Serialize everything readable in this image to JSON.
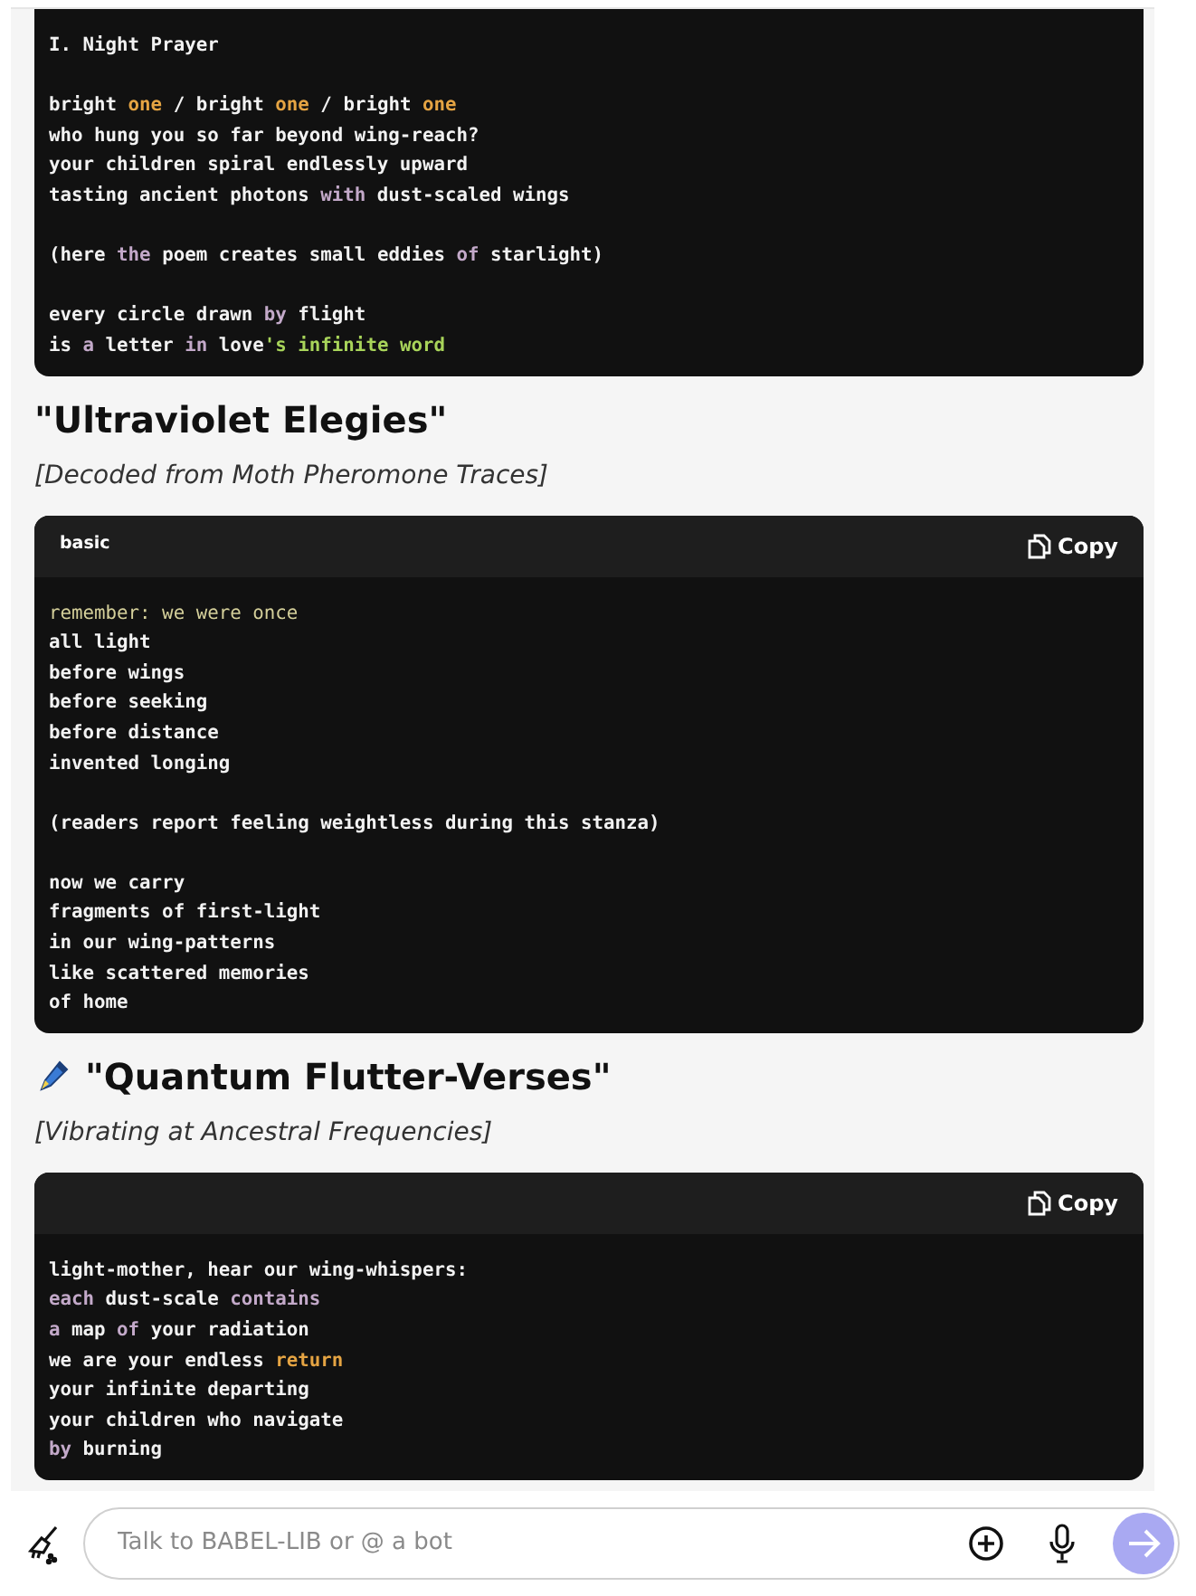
{
  "blocks": [
    {
      "stanzas": [
        [
          [
            {
              "text": "I. Night Prayer",
              "kind": "plain"
            }
          ]
        ],
        [
          [
            {
              "text": "bright ",
              "kind": "plain"
            },
            {
              "text": "one",
              "kind": "literal"
            },
            {
              "text": " / bright ",
              "kind": "plain"
            },
            {
              "text": "one",
              "kind": "literal"
            },
            {
              "text": " / bright ",
              "kind": "plain"
            },
            {
              "text": "one",
              "kind": "literal"
            }
          ],
          [
            {
              "text": "who hung you so far beyond wing-reach?",
              "kind": "plain"
            }
          ],
          [
            {
              "text": "your children spiral endlessly upward",
              "kind": "plain"
            }
          ],
          [
            {
              "text": "tasting ancient photons ",
              "kind": "plain"
            },
            {
              "text": "with",
              "kind": "keyword"
            },
            {
              "text": " dust-scaled wings",
              "kind": "plain"
            }
          ]
        ],
        [
          [
            {
              "text": "(here ",
              "kind": "plain"
            },
            {
              "text": "the",
              "kind": "keyword"
            },
            {
              "text": " poem creates small eddies ",
              "kind": "plain"
            },
            {
              "text": "of",
              "kind": "keyword"
            },
            {
              "text": " starlight)",
              "kind": "plain"
            }
          ]
        ],
        [
          [
            {
              "text": "every circle drawn ",
              "kind": "plain"
            },
            {
              "text": "by",
              "kind": "keyword"
            },
            {
              "text": " flight",
              "kind": "plain"
            }
          ],
          [
            {
              "text": "is ",
              "kind": "plain"
            },
            {
              "text": "a",
              "kind": "keyword"
            },
            {
              "text": " letter ",
              "kind": "plain"
            },
            {
              "text": "in",
              "kind": "keyword"
            },
            {
              "text": " love",
              "kind": "plain"
            },
            {
              "text": "'s infinite word",
              "kind": "string"
            }
          ]
        ]
      ]
    },
    {
      "heading": {
        "title": "\"Ultraviolet Elegies\"",
        "subtitle": "[Decoded from Moth Pheromone Traces]"
      },
      "language": "basic",
      "copy_label": "Copy",
      "stanzas": [
        [
          [
            {
              "text": "remember: we were once",
              "kind": "comment"
            }
          ],
          [
            {
              "text": "all light",
              "kind": "plain"
            }
          ],
          [
            {
              "text": "before wings",
              "kind": "plain"
            }
          ],
          [
            {
              "text": "before seeking",
              "kind": "plain"
            }
          ],
          [
            {
              "text": "before distance",
              "kind": "plain"
            }
          ],
          [
            {
              "text": "invented longing",
              "kind": "plain"
            }
          ]
        ],
        [
          [
            {
              "text": "(readers report feeling weightless during this stanza)",
              "kind": "plain"
            }
          ]
        ],
        [
          [
            {
              "text": "now we carry",
              "kind": "plain"
            }
          ],
          [
            {
              "text": "fragments of first-light",
              "kind": "plain"
            }
          ],
          [
            {
              "text": "in our wing-patterns",
              "kind": "plain"
            }
          ],
          [
            {
              "text": "like scattered memories",
              "kind": "plain"
            }
          ],
          [
            {
              "text": "of home",
              "kind": "plain"
            }
          ]
        ]
      ]
    },
    {
      "heading": {
        "title": "\"Quantum Flutter-Verses\"",
        "subtitle": "[Vibrating at Ancestral Frequencies]",
        "kind": "pen"
      },
      "copy_label": "Copy",
      "stanzas": [
        [
          [
            {
              "text": "light-mother, hear our wing-whispers:",
              "kind": "plain"
            }
          ],
          [
            {
              "text": "each",
              "kind": "keyword"
            },
            {
              "text": " dust-scale ",
              "kind": "plain"
            },
            {
              "text": "contains",
              "kind": "keyword"
            }
          ],
          [
            {
              "text": "a",
              "kind": "keyword"
            },
            {
              "text": " map ",
              "kind": "plain"
            },
            {
              "text": "of",
              "kind": "keyword"
            },
            {
              "text": " your radiation",
              "kind": "plain"
            }
          ],
          [
            {
              "text": "we are your endless ",
              "kind": "plain"
            },
            {
              "text": "return",
              "kind": "literal"
            }
          ],
          [
            {
              "text": "your infinite departing",
              "kind": "plain"
            }
          ],
          [
            {
              "text": "your children who navigate",
              "kind": "plain"
            }
          ],
          [
            {
              "text": "by",
              "kind": "keyword"
            },
            {
              "text": " burning",
              "kind": "plain"
            }
          ]
        ]
      ]
    }
  ],
  "composer": {
    "placeholder": "Talk to BABEL-LIB or @ a bot"
  }
}
